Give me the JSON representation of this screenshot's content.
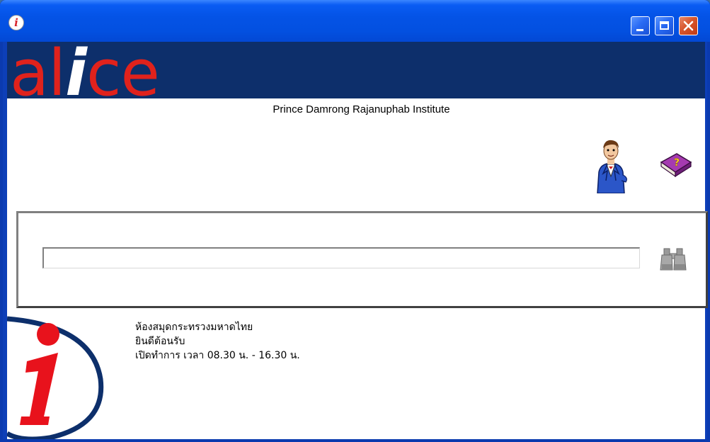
{
  "window": {
    "title": ""
  },
  "header": {
    "logo_prefix": "al",
    "logo_i": "i",
    "logo_suffix": "ce"
  },
  "institution": {
    "name": "Prince Damrong Rajanuphab Institute"
  },
  "search": {
    "value": "",
    "placeholder": ""
  },
  "welcome": {
    "line1": "ห้องสมุดกระทรวงมหาดไทย",
    "line2": "ยินดีต้อนรับ",
    "line3": "เปิดทำการ เวลา 08.30 น. - 16.30 น."
  },
  "icons": {
    "app": "info-icon",
    "librarian": "librarian-icon",
    "help": "help-book-icon",
    "search": "binoculars-icon",
    "info_logo": "info-logo"
  },
  "colors": {
    "logo_red": "#e0221c",
    "header_navy": "#0d2f6b",
    "titlebar_blue": "#0453e6"
  }
}
